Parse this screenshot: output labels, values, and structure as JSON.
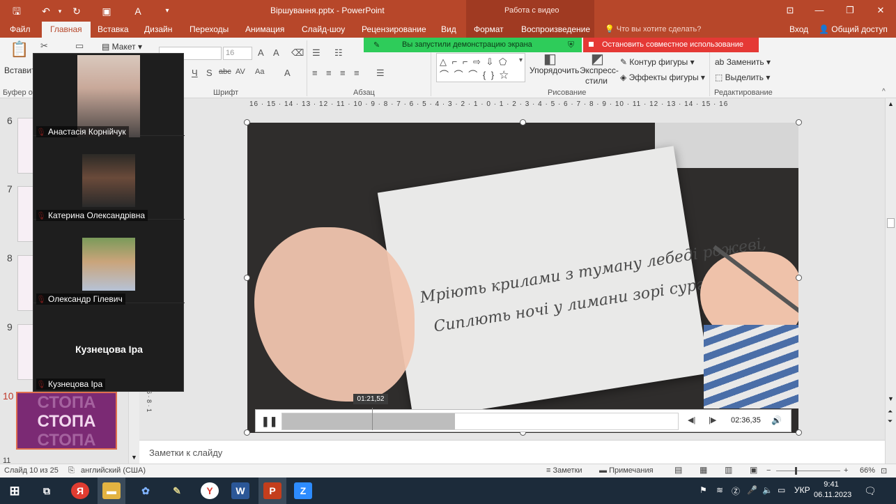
{
  "titlebar": {
    "title": "Віршування.pptx - PowerPoint",
    "context_group": "Работа с видео"
  },
  "tabs": {
    "file": "Файл",
    "home": "Главная",
    "insert": "Вставка",
    "design": "Дизайн",
    "transitions": "Переходы",
    "animation": "Анимация",
    "slideshow": "Слайд-шоу",
    "review": "Рецензирование",
    "view": "Вид",
    "format": "Формат",
    "playback": "Воспроизведение",
    "tell_me": "Что вы хотите сделать?",
    "sign_in": "Вход",
    "share": "Общий доступ"
  },
  "ribbon": {
    "paste": "Вставить",
    "clipboard": "Буфер об",
    "layout": "Макет",
    "font_group": "Шрифт",
    "font_size": "16",
    "paragraph_group": "Абзац",
    "drawing_group": "Рисование",
    "arrange": "Упорядочить",
    "quick_styles_1": "Экспресс-",
    "quick_styles_2": "стили",
    "shape_outline": "Контур фигуры",
    "shape_effects": "Эффекты фигуры",
    "replace": "Заменить",
    "select": "Выделить",
    "editing_group": "Редактирование"
  },
  "share_banner": {
    "sharing_text": "Вы запустили демонстрацию экрана",
    "stop_text": "Остановить совместное использование"
  },
  "participants": [
    {
      "name": "Анастасія Корнійчук"
    },
    {
      "name": "Катерина Олександрівна"
    },
    {
      "name": "Олександр Гілевич"
    },
    {
      "name": "Кузнецова Іра",
      "display_name": "Кузнецова Іра"
    }
  ],
  "thumbnails": {
    "numbers": [
      "6",
      "7",
      "8",
      "9",
      "10",
      "11"
    ],
    "selected_text": "СТОПА"
  },
  "ruler": {
    "marks": "16 · 15 · 14 · 13 · 12 · 11 · 10 · 9 · 8 · 7 · 6 · 5 · 4 · 3 · 2 · 1 · 0 · 1 · 2 · 3 · 4 · 5 · 6 · 7 · 8 · 9 · 10 · 11 · 12 · 13 · 14 · 15 · 16",
    "vertical": "6 · 8 · 1"
  },
  "video": {
    "line1": "Мріють крилами з туману лебеді рожеві,",
    "line2": "Сиплють ночі у лимани зорі сургучеві.",
    "hover_time": "01:21,52",
    "duration": "02:36,35",
    "progress_fraction": 0.437,
    "hover_fraction": 0.227
  },
  "notes": {
    "placeholder": "Заметки к слайду"
  },
  "statusbar": {
    "slide_info": "Слайд 10 из 25",
    "language": "английский (США)",
    "notes_btn": "Заметки",
    "comments_btn": "Примечания",
    "zoom": "66%"
  },
  "taskbar": {
    "lang": "УКР",
    "time": "9:41",
    "date": "06.11.2023"
  }
}
